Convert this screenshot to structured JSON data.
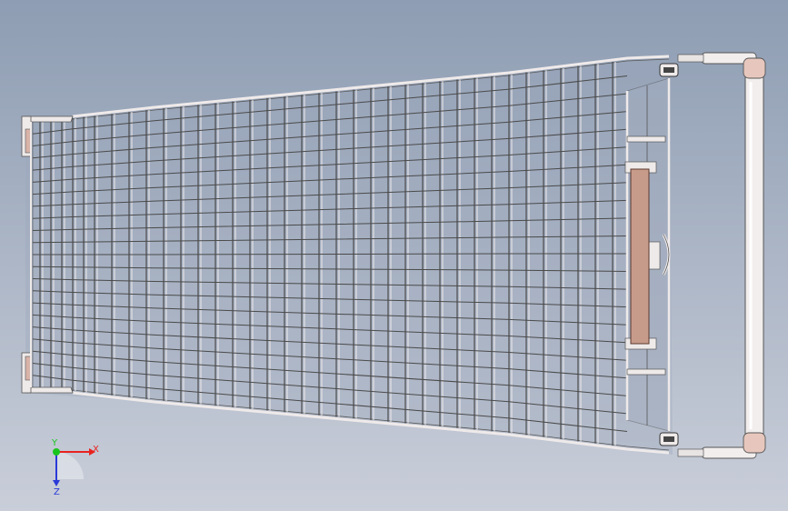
{
  "viewport": {
    "background_top": "#8e9db3",
    "background_bottom": "#c9ced9"
  },
  "model": {
    "name": "shopping-cart-top-view",
    "wire_color": "#4a4a4a",
    "frame_color": "#efeaea",
    "handle_color": "#f2eeee",
    "accent_color": "#c79b8a",
    "bumper_color": "#d8b3a8"
  },
  "triad": {
    "x_label": "X",
    "y_label": "Y",
    "z_label": "Z",
    "x_color": "#e8231f",
    "y_color": "#19c51c",
    "z_color": "#2a3ad8"
  }
}
